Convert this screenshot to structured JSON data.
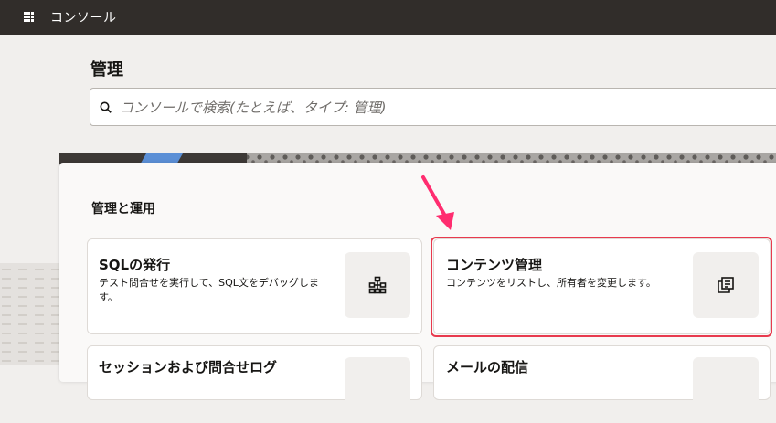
{
  "topbar": {
    "title": "コンソール",
    "apps_icon": "grid-menu-icon"
  },
  "page": {
    "title": "管理"
  },
  "search": {
    "placeholder": "コンソールで検索(たとえば、タイプ: 管理)",
    "icon": "search-icon"
  },
  "section": {
    "title": "管理と運用"
  },
  "cards": [
    {
      "title": "SQLの発行",
      "description": "テスト問合せを実行して、SQL文をデバッグします。",
      "icon": "hierarchy-icon"
    },
    {
      "title": "コンテンツ管理",
      "description": "コンテンツをリストし、所有者を変更します。",
      "icon": "copy-content-icon"
    },
    {
      "title": "セッションおよび問合せログ",
      "description": "",
      "icon": ""
    },
    {
      "title": "メールの配信",
      "description": "",
      "icon": ""
    }
  ],
  "annotation": {
    "highlight_color": "#e83a4e",
    "arrow_color": "#ff2d70"
  },
  "colors": {
    "topbar": "#312d2a",
    "background": "#f1efed"
  }
}
